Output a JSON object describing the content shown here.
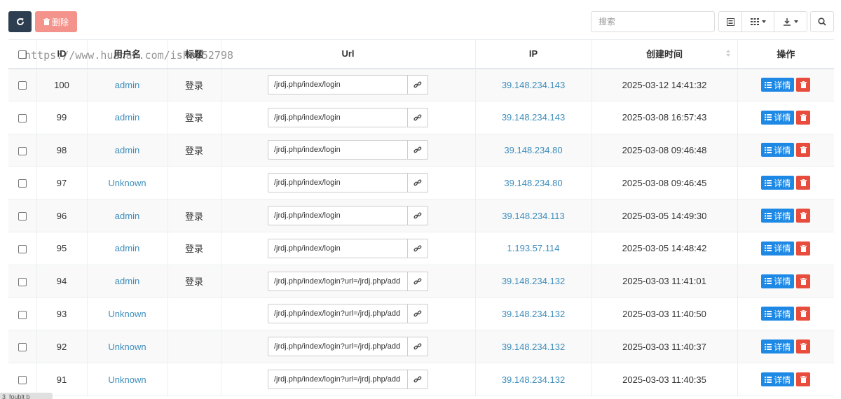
{
  "toolbar": {
    "delete_label": "删除",
    "search_placeholder": "搜索"
  },
  "table": {
    "columns": [
      "ID",
      "用户名",
      "标题",
      "Url",
      "IP",
      "创建时间",
      "操作"
    ],
    "rows": [
      {
        "id": "100",
        "username": "admin",
        "title": "登录",
        "url": "/jrdj.php/index/login",
        "ip": "39.148.234.143",
        "created": "2025-03-12 14:41:32"
      },
      {
        "id": "99",
        "username": "admin",
        "title": "登录",
        "url": "/jrdj.php/index/login",
        "ip": "39.148.234.143",
        "created": "2025-03-08 16:57:43"
      },
      {
        "id": "98",
        "username": "admin",
        "title": "登录",
        "url": "/jrdj.php/index/login",
        "ip": "39.148.234.80",
        "created": "2025-03-08 09:46:48"
      },
      {
        "id": "97",
        "username": "Unknown",
        "title": "",
        "url": "/jrdj.php/index/login",
        "ip": "39.148.234.80",
        "created": "2025-03-08 09:46:45"
      },
      {
        "id": "96",
        "username": "admin",
        "title": "登录",
        "url": "/jrdj.php/index/login",
        "ip": "39.148.234.113",
        "created": "2025-03-05 14:49:30"
      },
      {
        "id": "95",
        "username": "admin",
        "title": "登录",
        "url": "/jrdj.php/index/login",
        "ip": "1.193.57.114",
        "created": "2025-03-05 14:48:42"
      },
      {
        "id": "94",
        "username": "admin",
        "title": "登录",
        "url": "/jrdj.php/index/login?url=/jrdj.php/add",
        "ip": "39.148.234.132",
        "created": "2025-03-03 11:41:01"
      },
      {
        "id": "93",
        "username": "Unknown",
        "title": "",
        "url": "/jrdj.php/index/login?url=/jrdj.php/add",
        "ip": "39.148.234.132",
        "created": "2025-03-03 11:40:50"
      },
      {
        "id": "92",
        "username": "Unknown",
        "title": "",
        "url": "/jrdj.php/index/login?url=/jrdj.php/add",
        "ip": "39.148.234.132",
        "created": "2025-03-03 11:40:37"
      },
      {
        "id": "91",
        "username": "Unknown",
        "title": "",
        "url": "/jrdj.php/index/login?url=/jrdj.php/add",
        "ip": "39.148.234.132",
        "created": "2025-03-03 11:40:35"
      }
    ],
    "detail_label": "详情"
  },
  "watermark": "https://www.huzhan.com/ishop52798",
  "footer_stub": "3_foublt b",
  "colors": {
    "refresh_button": "#2c3e50",
    "delete_button": "#f4938b",
    "link": "#3c8dbc",
    "detail_button": "#1e88e5",
    "row_delete_button": "#e74c3c"
  },
  "icons": [
    "refresh-icon",
    "trash-icon",
    "list-icon",
    "columns-icon",
    "export-icon",
    "search-icon",
    "link-icon",
    "sort-icon"
  ]
}
